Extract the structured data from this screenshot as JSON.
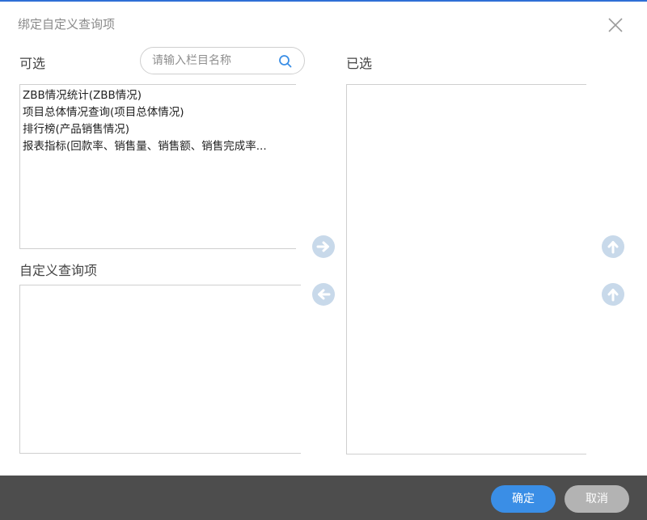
{
  "dialog": {
    "title": "绑定自定义查询项"
  },
  "available": {
    "label": "可选",
    "search_placeholder": "请输入栏目名称",
    "items": [
      "ZBB情况统计(ZBB情况)",
      "项目总体情况查询(项目总体情况)",
      "排行榜(产品销售情况)",
      "报表指标(回款率、销售量、销售额、销售完成率..."
    ]
  },
  "custom": {
    "label": "自定义查询项"
  },
  "selected": {
    "label": "已选"
  },
  "icons": {
    "close": "close-icon",
    "search": "search-icon",
    "move_right": "arrow-right-circle-icon",
    "move_left": "arrow-left-circle-icon",
    "move_up": "arrow-up-circle-icon",
    "move_down": "arrow-up-circle-icon"
  },
  "colors": {
    "accent": "#3a8ee6",
    "top_border": "#2e6fd6",
    "footer": "#4d4d4d",
    "cancel": "#b3b3b3",
    "arrow_circle": "#c8d9ea"
  },
  "footer": {
    "ok_label": "确定",
    "cancel_label": "取消"
  }
}
